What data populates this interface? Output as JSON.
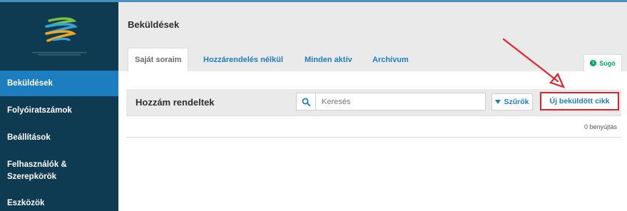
{
  "colors": {
    "sidebar_bg": "#0e3a52",
    "sidebar_active": "#1c7dbf",
    "accent": "#1c7dbf",
    "help_green": "#00a65a",
    "highlight_red": "#e2232a",
    "arrow_red": "#e2232a"
  },
  "sidebar": {
    "logo_icon": "ojs-logo-icon",
    "items": [
      {
        "label": "Beküldések",
        "active": true
      },
      {
        "label": "Folyóiratszámok",
        "active": false
      },
      {
        "label": "Beállítások",
        "active": false
      },
      {
        "label": "Felhasználók & Szerepkörök",
        "active": false
      },
      {
        "label": "Eszközök",
        "active": false
      }
    ]
  },
  "header": {
    "title": "Beküldések",
    "tabs": [
      {
        "label": "Saját soraim",
        "active": true
      },
      {
        "label": "Hozzárendelés nélkül",
        "active": false
      },
      {
        "label": "Minden aktív",
        "active": false
      },
      {
        "label": "Archívum",
        "active": false
      }
    ],
    "help_label": "Súgó",
    "help_icon": "info-icon"
  },
  "panel": {
    "title": "Hozzám rendeltek",
    "search_placeholder": "Keresés",
    "search_icon": "search-icon",
    "filter_label": "Szűrők",
    "filter_icon": "funnel-icon",
    "new_submission_label": "Új beküldött cikk",
    "count_text": "0 benyújtás"
  },
  "annotation": {
    "arrow_icon": "red-arrow-icon"
  }
}
